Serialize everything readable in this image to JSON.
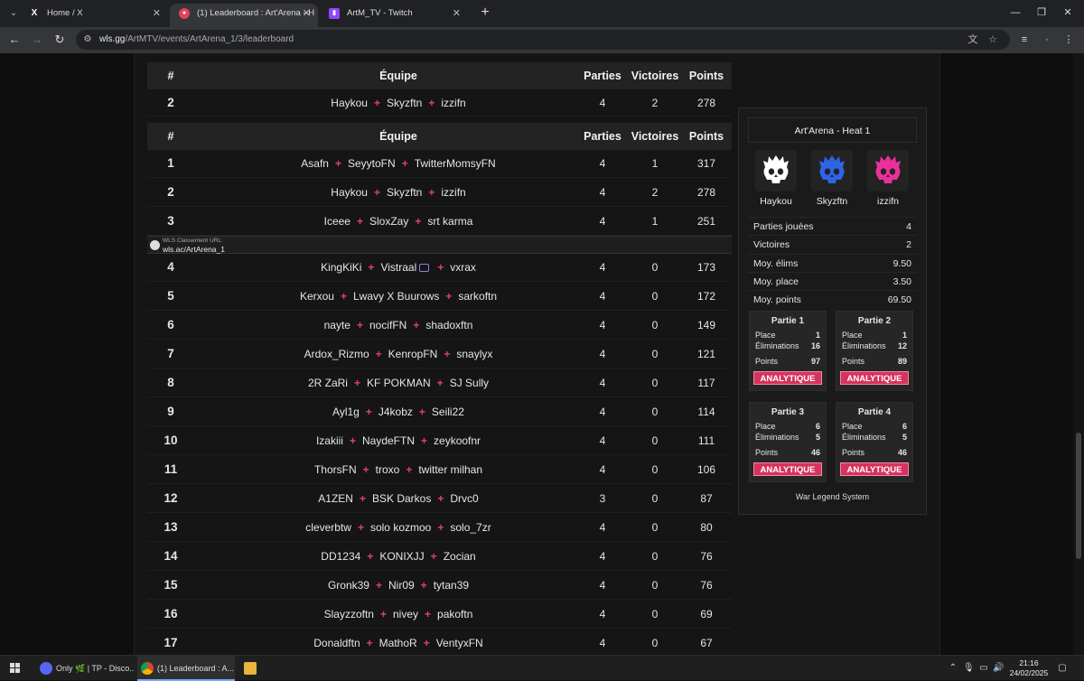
{
  "browser": {
    "tabs": [
      {
        "title": "Home / X",
        "icon": "x-logo-icon"
      },
      {
        "title": "(1) Leaderboard : Art'Arena - H",
        "icon": "wls-skull-icon"
      },
      {
        "title": "ArtM_TV - Twitch",
        "icon": "twitch-icon"
      }
    ],
    "url_host": "wls.gg",
    "url_path": "/ArtMTV/events/ArtArena_1/3/leaderboard"
  },
  "leaderboard": {
    "headers": {
      "rank": "#",
      "team": "Équipe",
      "games": "Parties",
      "wins": "Victoires",
      "points": "Points"
    },
    "highlight_row": {
      "rank": "2",
      "players": [
        "Haykou",
        "Skyzftn",
        "izzifn"
      ],
      "games": "4",
      "wins": "2",
      "points": "278"
    },
    "wls_caption": "WLS Classement URL:",
    "wls_url": "wls.ac/ArtArena_1",
    "rows": [
      {
        "rank": "1",
        "players": [
          "Asafn",
          "SeyytoFN",
          "TwitterMomsyFN"
        ],
        "games": "4",
        "wins": "1",
        "points": "317"
      },
      {
        "rank": "2",
        "players": [
          "Haykou",
          "Skyzftn",
          "izzifn"
        ],
        "games": "4",
        "wins": "2",
        "points": "278"
      },
      {
        "rank": "3",
        "players": [
          "Iceee",
          "SloxZay",
          "srt karma"
        ],
        "games": "4",
        "wins": "1",
        "points": "251"
      },
      {
        "rank": "4",
        "players": [
          "KingKiKi",
          "Vistraal",
          "vxrax"
        ],
        "games": "4",
        "wins": "0",
        "points": "173"
      },
      {
        "rank": "5",
        "players": [
          "Kerxou",
          "Lwavy X Buurows",
          "sarkoftn"
        ],
        "games": "4",
        "wins": "0",
        "points": "172"
      },
      {
        "rank": "6",
        "players": [
          "nayte",
          "nocifFN",
          "shadoxftn"
        ],
        "games": "4",
        "wins": "0",
        "points": "149"
      },
      {
        "rank": "7",
        "players": [
          "Ardox_Rizmo",
          "KenropFN",
          "snaylyx"
        ],
        "games": "4",
        "wins": "0",
        "points": "121"
      },
      {
        "rank": "8",
        "players": [
          "2R ZaRi",
          "KF POKMAN",
          "SJ Sully"
        ],
        "games": "4",
        "wins": "0",
        "points": "117"
      },
      {
        "rank": "9",
        "players": [
          "Ayl1g",
          "J4kobz",
          "Seili22"
        ],
        "games": "4",
        "wins": "0",
        "points": "114"
      },
      {
        "rank": "10",
        "players": [
          "Izakiii",
          "NaydeFTN",
          "zeykoofnr"
        ],
        "games": "4",
        "wins": "0",
        "points": "111"
      },
      {
        "rank": "11",
        "players": [
          "ThorsFN",
          "troxo",
          "twitter milhan"
        ],
        "games": "4",
        "wins": "0",
        "points": "106"
      },
      {
        "rank": "12",
        "players": [
          "A1ZEN",
          "BSK Darkos",
          "Drvc0"
        ],
        "games": "3",
        "wins": "0",
        "points": "87"
      },
      {
        "rank": "13",
        "players": [
          "cleverbtw",
          "solo kozmoo",
          "solo_7zr"
        ],
        "games": "4",
        "wins": "0",
        "points": "80"
      },
      {
        "rank": "14",
        "players": [
          "DD1234",
          "KONIXJJ",
          "Zocian"
        ],
        "games": "4",
        "wins": "0",
        "points": "76"
      },
      {
        "rank": "15",
        "players": [
          "Gronk39",
          "Nir09",
          "tytan39"
        ],
        "games": "4",
        "wins": "0",
        "points": "76"
      },
      {
        "rank": "16",
        "players": [
          "Slayzzoftn",
          "nivey",
          "pakoftn"
        ],
        "games": "4",
        "wins": "0",
        "points": "69"
      },
      {
        "rank": "17",
        "players": [
          "Donaldftn",
          "MathoR",
          "VentyxFN"
        ],
        "games": "4",
        "wins": "0",
        "points": "67"
      }
    ]
  },
  "side_card": {
    "title": "Art'Arena - Heat 1",
    "players": [
      {
        "name": "Haykou",
        "color": "#ffffff"
      },
      {
        "name": "Skyzftn",
        "color": "#2f63e8"
      },
      {
        "name": "izzifn",
        "color": "#ec2f9b"
      }
    ],
    "stats": [
      {
        "label": "Parties jouées",
        "value": "4"
      },
      {
        "label": "Victoires",
        "value": "2"
      },
      {
        "label": "Moy. élims",
        "value": "9.50"
      },
      {
        "label": "Moy. place",
        "value": "3.50"
      },
      {
        "label": "Moy. points",
        "value": "69.50"
      }
    ],
    "games": [
      {
        "title": "Partie 1",
        "place": "1",
        "elims": "16",
        "points": "97"
      },
      {
        "title": "Partie 2",
        "place": "1",
        "elims": "12",
        "points": "89"
      },
      {
        "title": "Partie 3",
        "place": "6",
        "elims": "5",
        "points": "46"
      },
      {
        "title": "Partie 4",
        "place": "6",
        "elims": "5",
        "points": "46"
      }
    ],
    "labels": {
      "place": "Place",
      "elims": "Éliminations",
      "points": "Points",
      "button": "ANALYTIQUE"
    },
    "footer": "War Legend System"
  },
  "taskbar": {
    "apps": [
      {
        "title": "Only 🌿 | TP - Disco...",
        "icon": "discord-icon",
        "color": "#5865f2"
      },
      {
        "title": "(1) Leaderboard : A...",
        "icon": "chrome-icon",
        "color": "#e8a33b"
      }
    ],
    "time": "21:16",
    "date": "24/02/2025"
  }
}
